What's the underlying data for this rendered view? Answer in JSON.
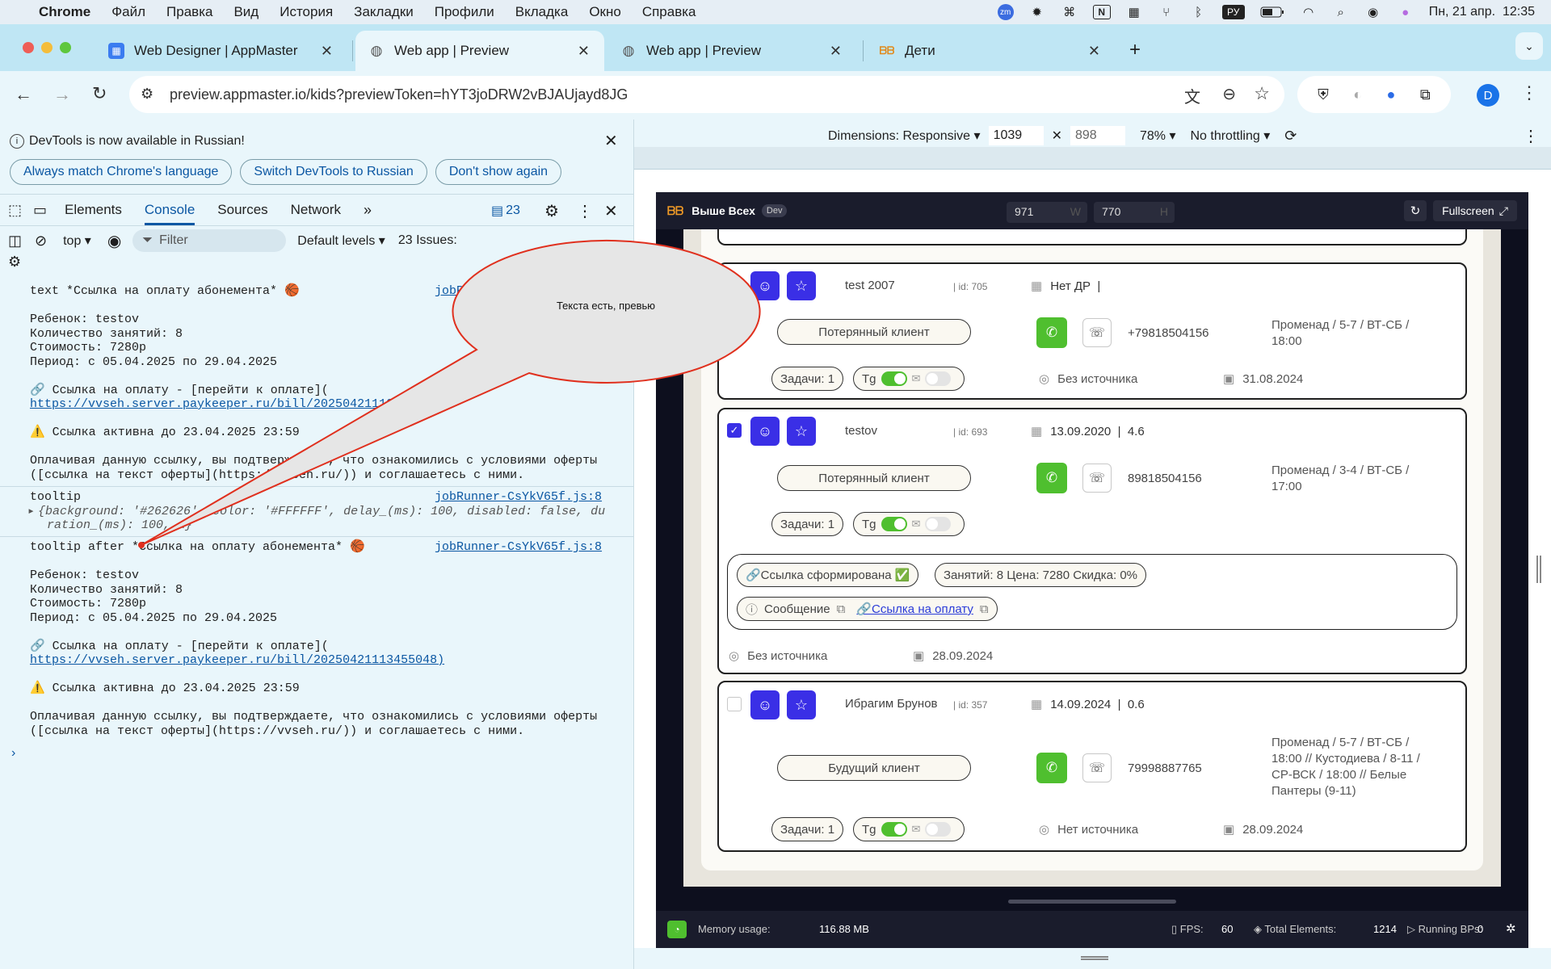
{
  "menubar": {
    "items": [
      "Chrome",
      "Файл",
      "Правка",
      "Вид",
      "История",
      "Закладки",
      "Профили",
      "Вкладка",
      "Окно",
      "Справка"
    ],
    "lang": "РУ",
    "datetime": "Пн, 21 апр.  12:35"
  },
  "tabs": [
    {
      "title": "Web Designer | AppMaster"
    },
    {
      "title": "Web app | Preview"
    },
    {
      "title": "Web app | Preview"
    },
    {
      "title": "Дети"
    }
  ],
  "address": {
    "url": "preview.appmaster.io/kids?previewToken=hYT3joDRW2vBJAUjayd8JG"
  },
  "profile_initial": "D",
  "devtools": {
    "notice": "DevTools is now available in Russian!",
    "btn_match": "Always match Chrome's language",
    "btn_switch": "Switch DevTools to Russian",
    "btn_dont": "Don't show again",
    "tabs": [
      "Elements",
      "Console",
      "Sources",
      "Network"
    ],
    "badge_count": "23",
    "context": "top",
    "filter_placeholder": "Filter",
    "levels": "Default levels",
    "issues": "23 Issues:",
    "console_lines": [
      "text *Ссылка на оплату абонемента* 🏀",
      "",
      "Ребенок: testov",
      "Количество занятий: 8",
      "Стоимость: 7280р",
      "Период: с 05.04.2025 по 29.04.2025",
      "",
      "🔗 Ссылка на оплату - [перейти к оплате](",
      "https://vvseh.server.paykeeper.ru/bill/20250421113455048)",
      "",
      "⚠️ Ссылка активна до 23.04.2025 23:59",
      "",
      "Оплачивая данную ссылку, вы подтверждаете, что ознакомились с условиями оферты",
      "([ссылка на текст оферты](https://vvseh.ru/)) и соглашаетесь с ними."
    ],
    "src1": "jobR",
    "tooltip_label": "tooltip",
    "tooltip_obj_1": "{background: '#262626', color: '#FFFFFF', delay_(ms): 100, disabled: false, du",
    "tooltip_obj_2": "ration_(ms): 100, …}",
    "src_file": "jobRunner-CsYkV65f.js:8",
    "after_line": "tooltip after *Ссылка на оплату абонемента* 🏀",
    "console_lines_2": [
      "",
      "Ребенок: testov",
      "Количество занятий: 8",
      "Стоимость: 7280р",
      "Период: с 05.04.2025 по 29.04.2025",
      "",
      "🔗 Ссылка на оплату - [перейти к оплате](",
      "https://vvseh.server.paykeeper.ru/bill/20250421113455048)",
      "",
      "⚠️ Ссылка активна до 23.04.2025 23:59",
      "",
      "Оплачивая данную ссылку, вы подтверждаете, что ознакомились с условиями оферты",
      "([ссылка на текст оферты](https://vvseh.ru/)) и соглашаетесь с ними."
    ]
  },
  "device": {
    "dimensions": "Dimensions: Responsive",
    "width": "1039",
    "height": "898",
    "zoom": "78%",
    "throttle": "No throttling"
  },
  "app": {
    "name": "Выше Всех",
    "env": "Dev",
    "w": "971",
    "w_suffix": "W",
    "h": "770",
    "h_suffix": "H",
    "fullscreen": "Fullscreen",
    "cards": [
      {
        "name": "test 2007",
        "id": "| id: 705",
        "dob": "Нет ДР  |",
        "status": "Потерянный клиент",
        "phone": "+79818504156",
        "location": "Променад / 5-7 / ВТ-СБ / 18:00",
        "tasks": "Задачи: 1",
        "tg": "Tg",
        "source": "Без источника",
        "date": "31.08.2024",
        "checked": false
      },
      {
        "name": "testov",
        "id": "| id: 693",
        "dob": "13.09.2020  |  4.6",
        "status": "Потерянный клиент",
        "phone": "89818504156",
        "location": "Променад / 3-4 / ВТ-СБ / 17:00",
        "tasks": "Задачи: 1",
        "tg": "Tg",
        "source": "Без источника",
        "date": "28.09.2024",
        "checked": true,
        "link_formed": "🔗Ссылка сформирована ✅",
        "lessons": "Занятий: 8 Цена: 7280 Скидка: 0%",
        "message": "Сообщение",
        "pay_link": "🔗Ссылка на оплату"
      },
      {
        "name": "Ибрагим Брунов",
        "id": "| id: 357",
        "dob": "14.09.2024  |  0.6",
        "status": "Будущий клиент",
        "phone": "79998887765",
        "location": "Променад / 5-7 / ВТ-СБ / 18:00 // Кустодиева / 8-11 / СР-ВСК / 18:00 // Белые Пантеры (9-11)",
        "tasks": "Задачи: 1",
        "tg": "Tg",
        "source": "Нет источника",
        "date": "28.09.2024",
        "checked": false
      }
    ]
  },
  "status": {
    "memory_label": "Memory usage:",
    "memory": "116.88 MB",
    "fps_label": "FPS:",
    "fps": "60",
    "elements_label": "Total Elements:",
    "elements": "1214",
    "bps_label": "Running BPs:",
    "bps": "0"
  },
  "callout": {
    "text": "Текста есть, превью",
    "fill": "#e6e6e6",
    "stroke": "#e0301e"
  }
}
